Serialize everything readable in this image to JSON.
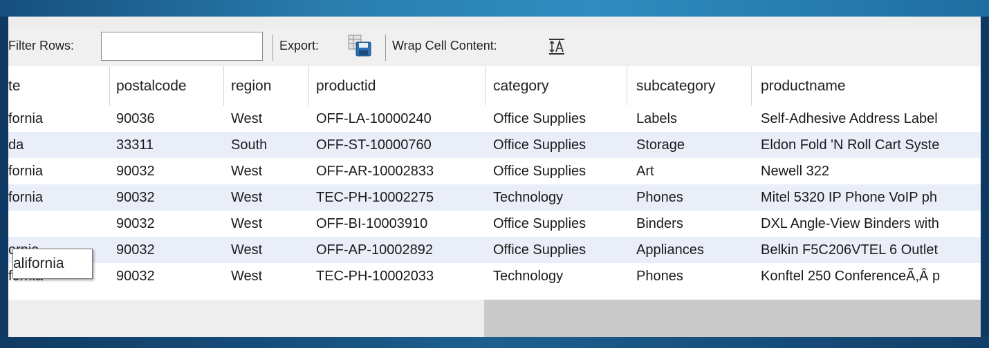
{
  "toolbar": {
    "filter_label": "Filter Rows:",
    "filter_value": "",
    "export_label": "Export:",
    "wrap_label": "Wrap Cell Content:"
  },
  "table": {
    "columns": [
      "te",
      "postalcode",
      "region",
      "productid",
      "category",
      "subcategory",
      "productname"
    ],
    "rows": [
      [
        "fornia",
        "90036",
        "West",
        "OFF-LA-10000240",
        "Office Supplies",
        "Labels",
        "Self-Adhesive Address Label"
      ],
      [
        "da",
        "33311",
        "South",
        "OFF-ST-10000760",
        "Office Supplies",
        "Storage",
        "Eldon Fold 'N Roll Cart Syste"
      ],
      [
        "fornia",
        "90032",
        "West",
        "OFF-AR-10002833",
        "Office Supplies",
        "Art",
        "Newell 322"
      ],
      [
        "fornia",
        "90032",
        "West",
        "TEC-PH-10002275",
        "Technology",
        "Phones",
        "Mitel 5320 IP Phone VoIP ph"
      ],
      [
        "",
        "90032",
        "West",
        "OFF-BI-10003910",
        "Office Supplies",
        "Binders",
        "DXL Angle-View Binders with"
      ],
      [
        "ornia",
        "90032",
        "West",
        "OFF-AP-10002892",
        "Office Supplies",
        "Appliances",
        "Belkin F5C206VTEL 6 Outlet"
      ],
      [
        "fornia",
        "90032",
        "West",
        "TEC-PH-10002033",
        "Technology",
        "Phones",
        "Konftel 250 ConferenceÃ,Â p"
      ]
    ]
  },
  "tooltip": {
    "text": "alifornia"
  },
  "icons": {
    "export": "export-grid-save-icon",
    "wrap": "wrap-cell-content-icon"
  },
  "colors": {
    "frame": "#1b4a73",
    "row_alt": "#e9eef8",
    "toolbar": "#f0f0f0"
  }
}
